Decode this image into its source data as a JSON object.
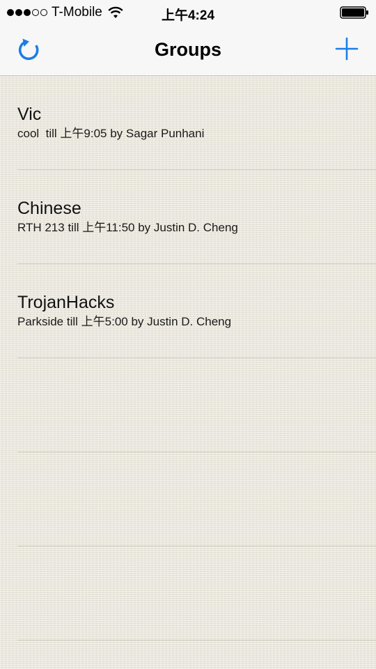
{
  "status_bar": {
    "carrier": "T-Mobile",
    "time": "上午4:24",
    "signal_bars_filled": 3,
    "signal_bars_total": 5,
    "icons": [
      "signal-dots-icon",
      "wifi-icon",
      "battery-icon"
    ]
  },
  "nav": {
    "title": "Groups",
    "left_icon": "refresh-icon",
    "right_icon": "plus-icon",
    "accent_color": "#1a7ee8"
  },
  "groups": [
    {
      "name": "Vic",
      "detail": "cool  till 上午9:05 by Sagar Punhani"
    },
    {
      "name": "Chinese",
      "detail": "RTH 213 till 上午11:50 by Justin D. Cheng"
    },
    {
      "name": "TrojanHacks",
      "detail": "Parkside till 上午5:00 by Justin D. Cheng"
    }
  ]
}
